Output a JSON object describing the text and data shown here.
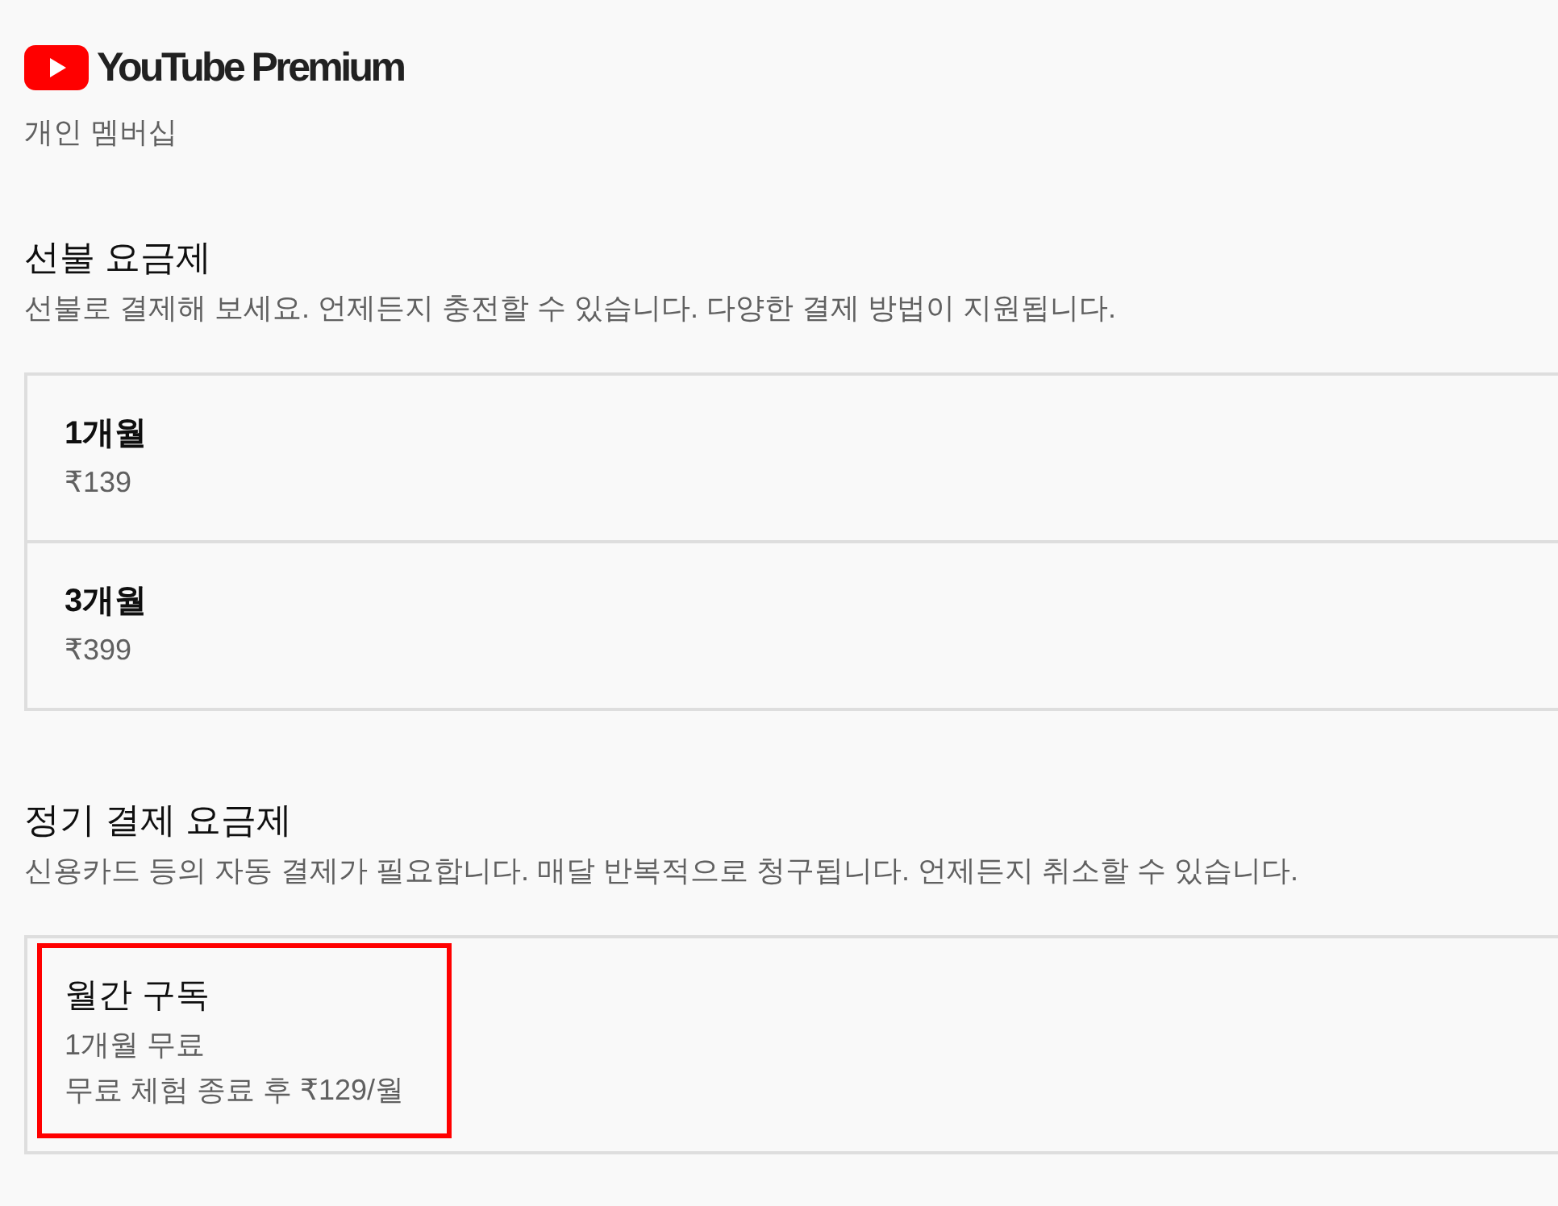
{
  "header": {
    "product": "YouTube Premium",
    "membership": "개인 멤버십"
  },
  "sections": [
    {
      "title": "선불 요금제",
      "description": "선불로 결제해 보세요. 언제든지 충전할 수 있습니다. 다양한 결제 방법이 지원됩니다.",
      "plans": [
        {
          "name": "1개월",
          "details": [
            "₹139"
          ],
          "highlighted": false
        },
        {
          "name": "3개월",
          "details": [
            "₹399"
          ],
          "highlighted": false
        }
      ]
    },
    {
      "title": "정기 결제 요금제",
      "description": "신용카드 등의 자동 결제가 필요합니다. 매달 반복적으로 청구됩니다. 언제든지 취소할 수 있습니다.",
      "plans": [
        {
          "name": "월간 구독",
          "details": [
            "1개월 무료",
            "무료 체험 종료 후 ₹129/월"
          ],
          "highlighted": true
        }
      ]
    }
  ]
}
